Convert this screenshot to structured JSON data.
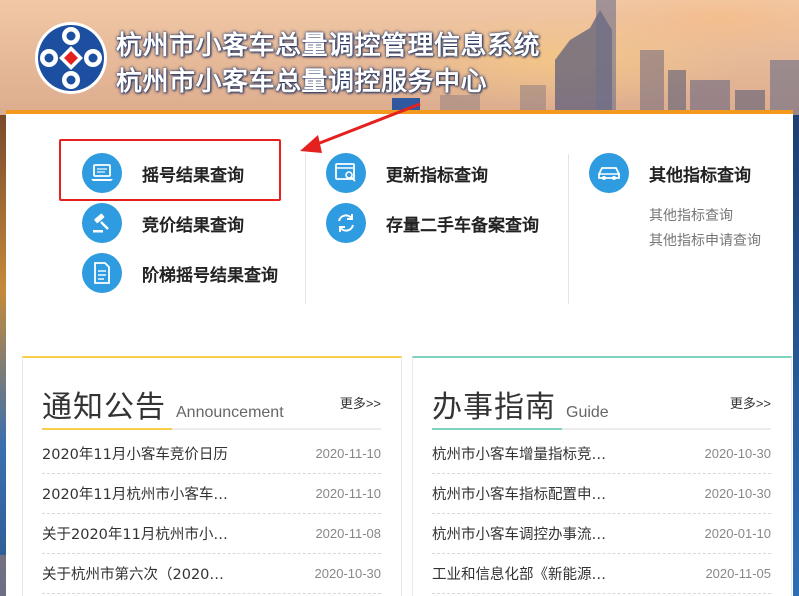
{
  "header": {
    "title_line1": "杭州市小客车总量调控管理信息系统",
    "title_line2": "杭州市小客车总量调控服务中心"
  },
  "queries": {
    "col1": [
      {
        "label": "摇号结果查询",
        "icon": "laptop-icon"
      },
      {
        "label": "竞价结果查询",
        "icon": "gavel-icon"
      },
      {
        "label": "阶梯摇号结果查询",
        "icon": "document-icon"
      }
    ],
    "col2": [
      {
        "label": "更新指标查询",
        "icon": "browser-search-icon"
      },
      {
        "label": "存量二手车备案查询",
        "icon": "refresh-icon"
      }
    ],
    "col3": {
      "label": "其他指标查询",
      "icon": "car-icon",
      "links": [
        "其他指标查询",
        "其他指标申请查询"
      ]
    }
  },
  "notice": {
    "title": "通知公告",
    "subtitle": "Announcement",
    "more": "更多>>",
    "items": [
      {
        "text": "2020年11月小客车竞价日历",
        "date": "2020-11-10"
      },
      {
        "text": "2020年11月杭州市小客车…",
        "date": "2020-11-10"
      },
      {
        "text": "关于2020年11月杭州市小…",
        "date": "2020-11-08"
      },
      {
        "text": "关于杭州市第六次（2020…",
        "date": "2020-10-30"
      }
    ]
  },
  "guide": {
    "title": "办事指南",
    "subtitle": "Guide",
    "more": "更多>>",
    "items": [
      {
        "text": "杭州市小客车增量指标竞…",
        "date": "2020-10-30"
      },
      {
        "text": "杭州市小客车指标配置申…",
        "date": "2020-10-30"
      },
      {
        "text": "杭州市小客车调控办事流…",
        "date": "2020-01-10"
      },
      {
        "text": "工业和信息化部《新能源…",
        "date": "2020-11-05"
      }
    ]
  },
  "colors": {
    "accent_orange": "#f39a1e",
    "icon_blue": "#2f9be0",
    "highlight_red": "#e5211f",
    "notice_yellow": "#f7cf4b",
    "guide_teal": "#7fd3c0"
  }
}
